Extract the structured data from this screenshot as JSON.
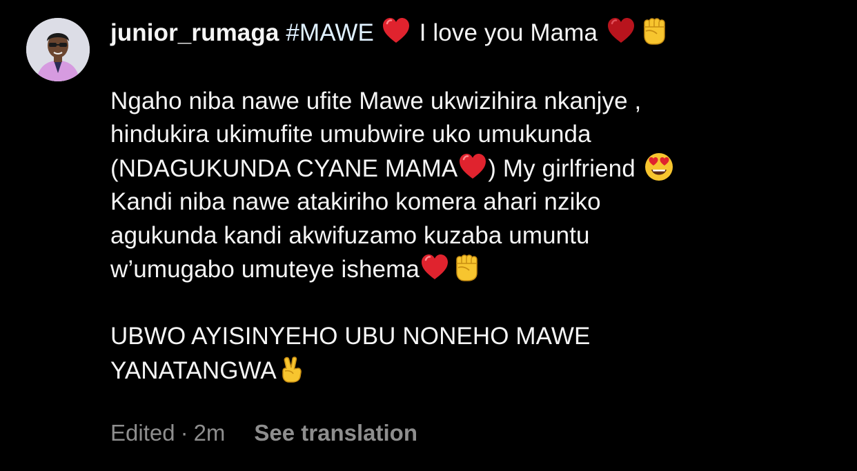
{
  "comment": {
    "username": "junior_rumaga",
    "hashtag": "#MAWE",
    "line1_text": "I love you Mama",
    "paragraph1": [
      "Ngaho niba nawe ufite Mawe ukwizihira nkanjye ,",
      "hindukira ukimufite umubwire uko umukunda",
      "(NDAGUKUNDA CYANE MAMA",
      ") My girlfriend",
      "Kandi niba nawe atakiriho komera ahari nziko",
      "agukunda kandi akwifuzamo kuzaba umuntu",
      "w’umugabo umuteye ishema"
    ],
    "paragraph2": [
      "UBWO AYISINYEHO UBU NONEHO MAWE",
      "YANATANGWA"
    ]
  },
  "footer": {
    "edited": "Edited",
    "separator": "·",
    "time": "2m",
    "see_translation": "See translation"
  },
  "icons": {
    "heart": "red-heart-emoji",
    "fist": "raised-fist-emoji",
    "heart_eyes": "heart-eyes-emoji",
    "victory": "victory-hand-emoji"
  },
  "colors": {
    "background": "#000000",
    "text": "#f5f5f5",
    "muted": "#8e8e8e",
    "heart": "#e0232e",
    "emoji_yellow": "#f7c52f"
  }
}
